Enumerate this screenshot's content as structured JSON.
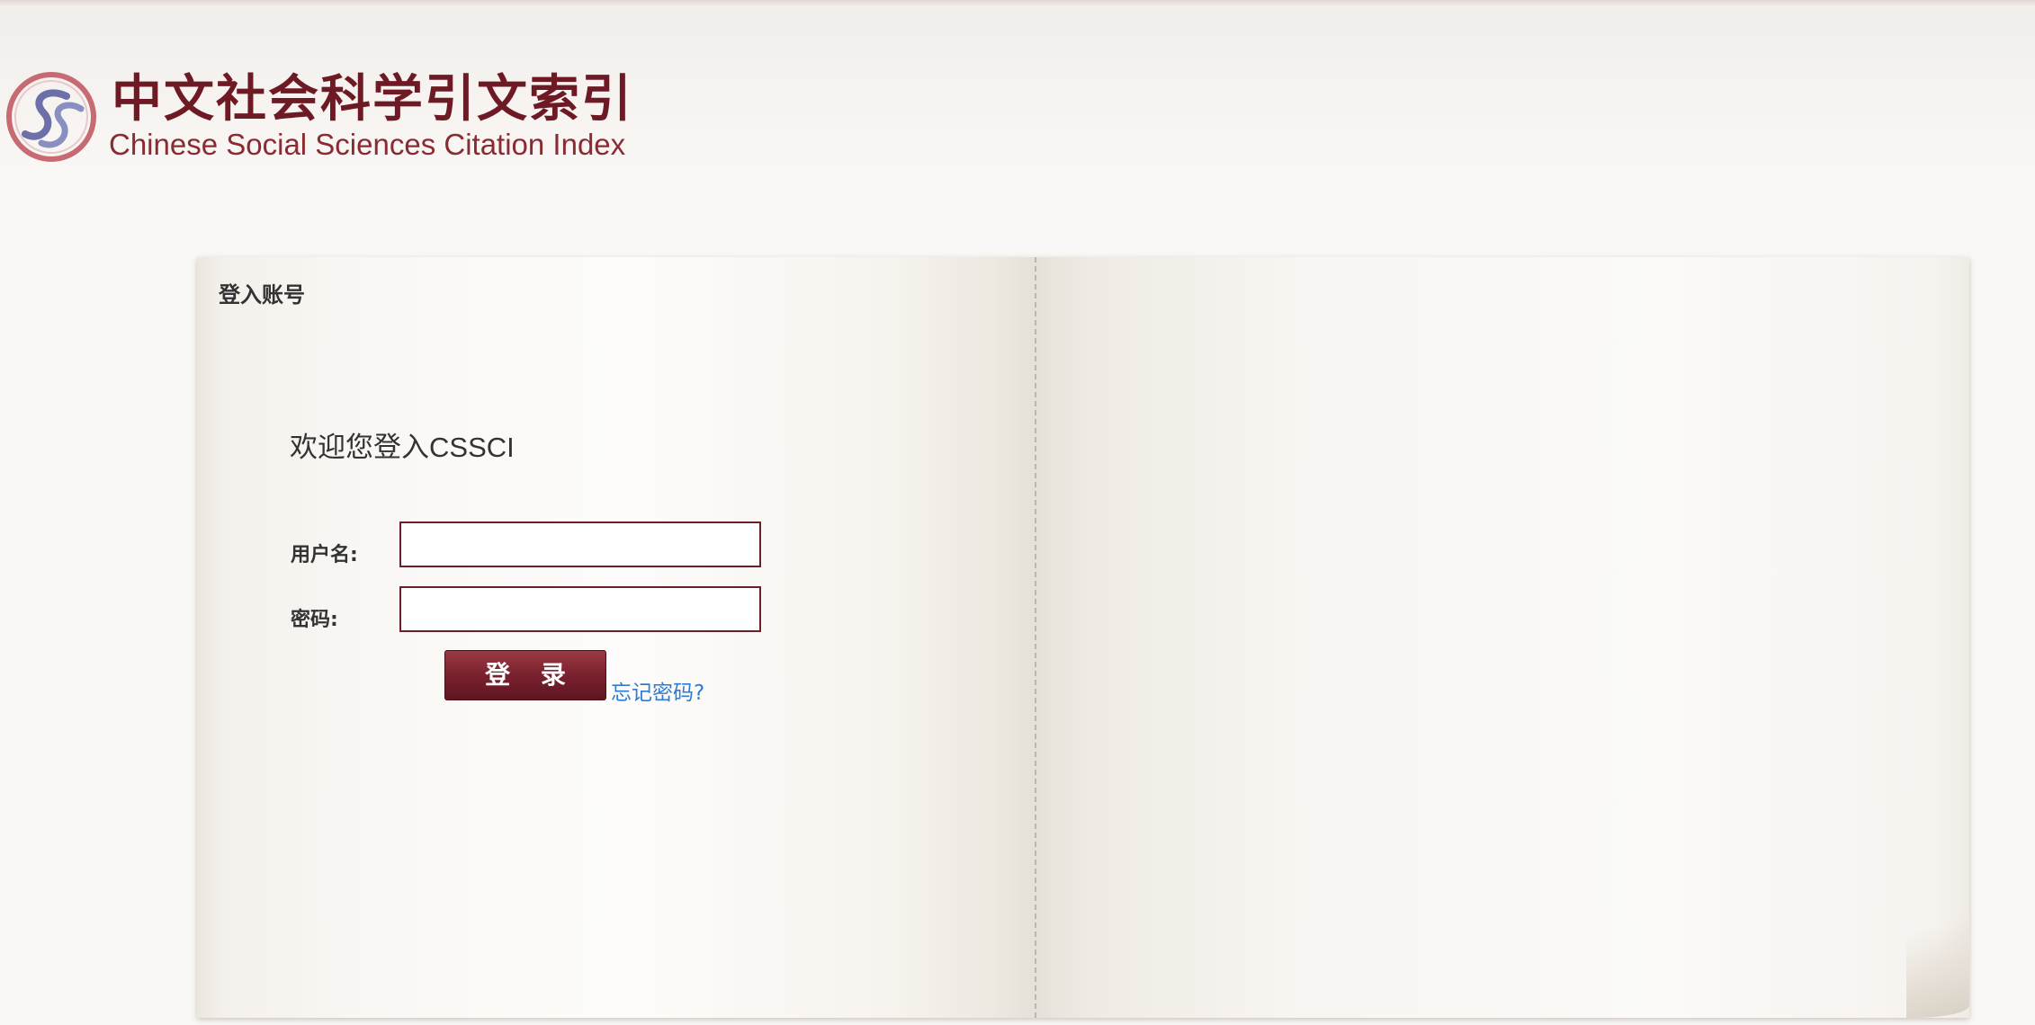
{
  "header": {
    "title_cn": "中文社会科学引文索引",
    "title_en": "Chinese Social Sciences Citation Index",
    "logo_icon": "csscI-logo-icon"
  },
  "login": {
    "section_title": "登入账号",
    "welcome": "欢迎您登入CSSCI",
    "username_label": "用户名:",
    "password_label": "密码:",
    "username_value": "",
    "password_value": "",
    "login_button": "登 录",
    "forgot_link": "忘记密码?"
  },
  "colors": {
    "brand": "#6e1a24",
    "button": "#7c2330",
    "link": "#2f7ad6",
    "input_border": "#6b1f28"
  }
}
